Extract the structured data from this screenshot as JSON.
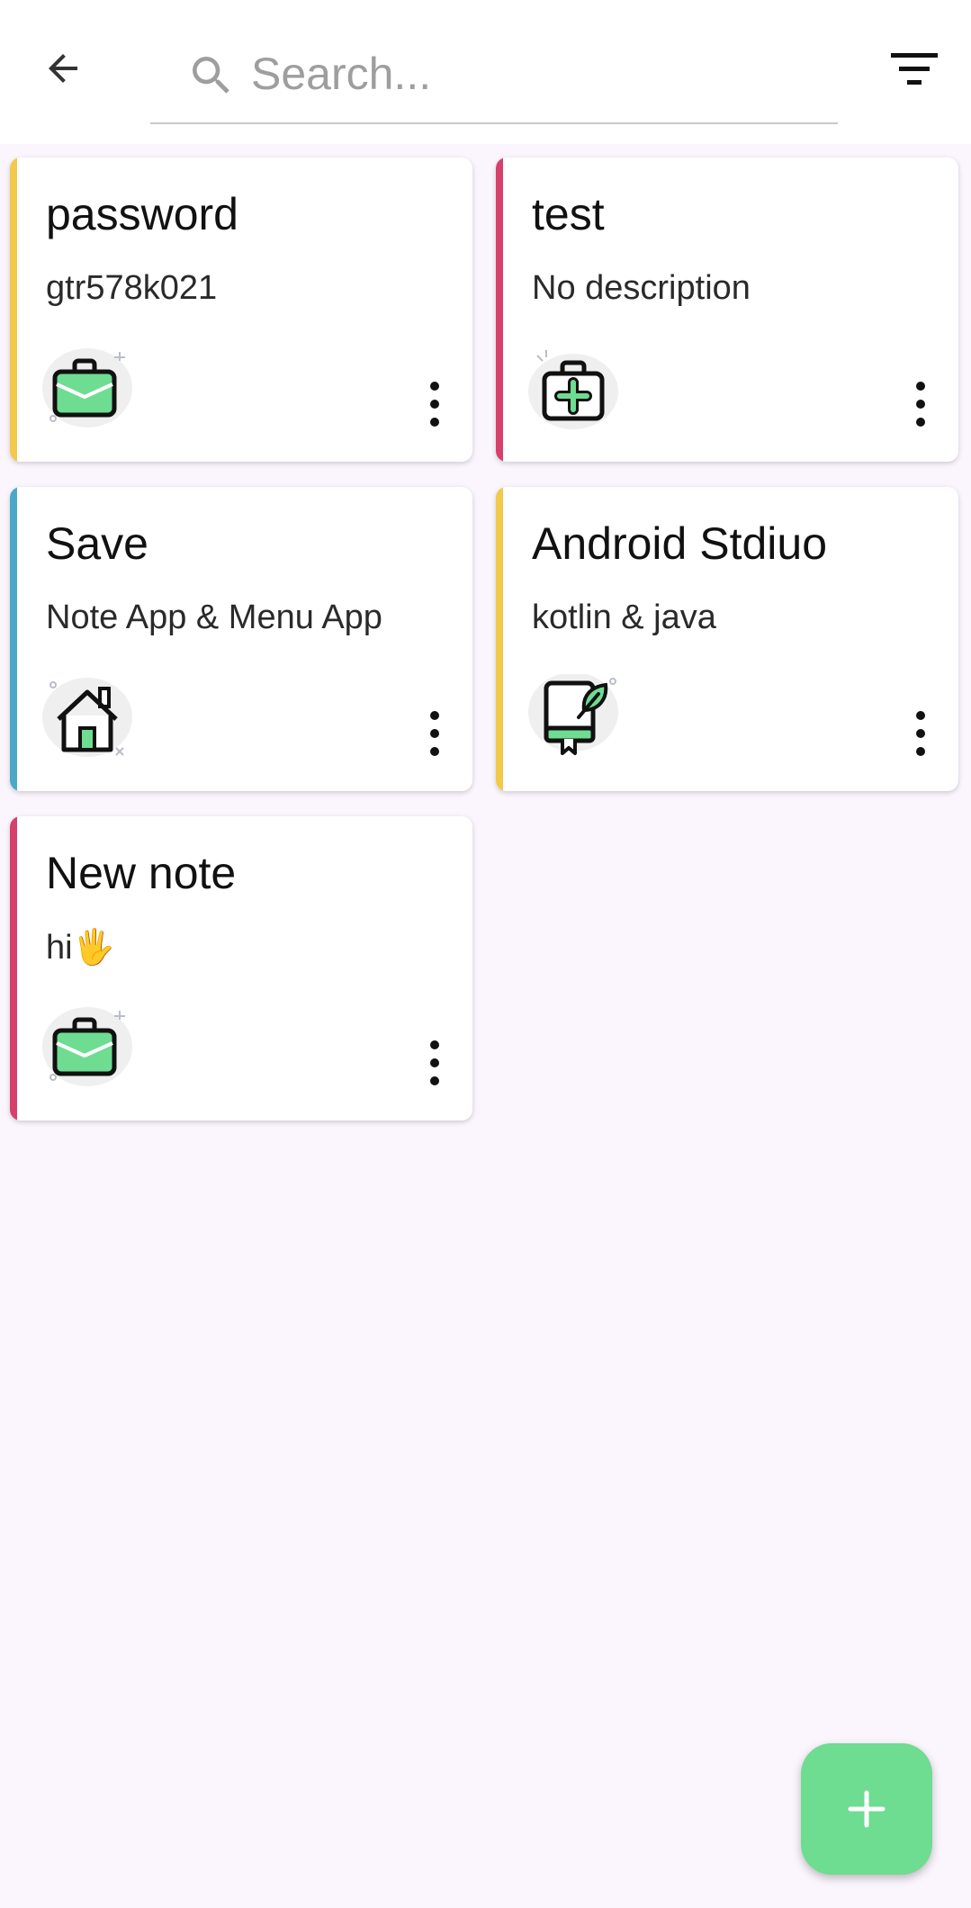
{
  "search": {
    "placeholder": "Search..."
  },
  "colors": {
    "yellow": "#f3c94b",
    "red": "#d6406a",
    "blue": "#4aa9c8",
    "green": "#6edc91"
  },
  "notes": [
    {
      "title": "password",
      "description": "gtr578k021",
      "accent": "yellow",
      "icon": "briefcase-icon"
    },
    {
      "title": "test",
      "description": "No description",
      "accent": "red",
      "icon": "first-aid-kit-icon"
    },
    {
      "title": "Save",
      "description": "Note App & Menu App",
      "accent": "blue",
      "icon": "house-icon"
    },
    {
      "title": "Android Stdiuo",
      "description": "kotlin & java",
      "accent": "yellow",
      "icon": "book-leaf-icon"
    },
    {
      "title": "New note",
      "description": "hi🖐",
      "accent": "red",
      "icon": "briefcase-icon"
    }
  ],
  "fab": {
    "icon": "plus-icon"
  }
}
